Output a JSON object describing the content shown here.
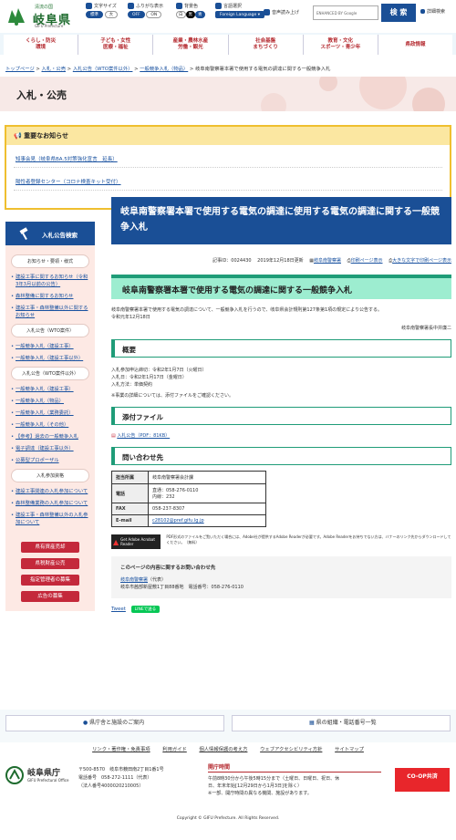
{
  "header": {
    "logo_sub": "清流の国",
    "logo_main": "岐阜県",
    "logo_en": "GIFU Prefecture",
    "font_size": {
      "label": "文字サイズ",
      "opt1": "標準",
      "opt2": "大"
    },
    "furigana": {
      "label": "ふりがな表示",
      "off": "OFF",
      "on": "ON"
    },
    "bg_color": {
      "label": "背景色",
      "opt1": "白",
      "opt2": "黒",
      "opt3": "青"
    },
    "language": {
      "label": "言語選択",
      "button": "Foreign Language ▾"
    },
    "voice": "音声読み上げ",
    "search_placeholder": "ENHANCED BY Google",
    "search_button": "検 索",
    "detail_search": "詳細検索",
    "colors": {
      "primary": "#1a4f96",
      "green": "#1f9c78",
      "red": "#c4293b"
    }
  },
  "nav": [
    {
      "l1": "くらし・防災",
      "l2": "環境"
    },
    {
      "l1": "子ども・女性",
      "l2": "医療・福祉"
    },
    {
      "l1": "産業・農林水産",
      "l2": "労働・観光"
    },
    {
      "l1": "社会基盤",
      "l2": "まちづくり"
    },
    {
      "l1": "教育・文化",
      "l2": "スポーツ・青少年"
    },
    {
      "l1": "県政情報",
      "l2": ""
    }
  ],
  "breadcrumb": {
    "items": [
      "トップページ",
      "入札・公売",
      "入札公告（WTO案件以外）",
      "一般競争入札（物品）"
    ],
    "current": "岐阜南警察署本署で使用する電気の調達に関する一般競争入札"
  },
  "banner_title": "入札・公売",
  "notice": {
    "title": "重要なお知らせ",
    "items": [
      "知事会見（岐阜県BA.5対策強化宣言　延長）",
      "陽性者登録センター（コロナ検査キット受付）"
    ]
  },
  "sidebar": {
    "title": "入札公告検索",
    "sec1": "お知らせ・要領・様式",
    "sec1_links": [
      "建設工事に関するお知らせ（令和3年3月以前の公告）",
      "森林整備に関するお知らせ",
      "建設工事・森林整備以外に関するお知らせ"
    ],
    "sec2": "入札公告（WTO案件）",
    "sec2_links": [
      "一般競争入札（建設工事）",
      "一般競争入札（建設工事以外）"
    ],
    "sec3": "入札公告（WTO案件以外）",
    "sec3_links": [
      "一般競争入札（建設工事）",
      "一般競争入札（物品）",
      "一般競争入札（業務委託）",
      "一般競争入札（その他）",
      "【参考】過去の一般競争入札",
      "電子調達（建設工事以外）",
      "公募型プロポーザル"
    ],
    "sec4": "入札参加資格",
    "sec4_links": [
      "建設工事関連の入札参加について",
      "森林整備業務の入札参加について",
      "建設工事・森林整備以外の入札参加について"
    ],
    "buttons": [
      "県有資産売却",
      "県税財産公売",
      "指定管理者の募集",
      "広告の募集"
    ]
  },
  "main": {
    "title": "岐阜南警察署本署で使用する電気の調達に使用する電気の調達に関する一般競争入札",
    "meta_id": "記事ID：0024430",
    "meta_date": "2019年12月18日更新",
    "meta_dept": "岐阜南警察署",
    "meta_print": "印刷ページ表示",
    "meta_large": "大きな文字で印刷ページ表示",
    "h2": "岐阜南警察署本署で使用する電気の調達に関する一般競争入札",
    "intro1": "岐阜南警察署本署で使用する電気の調達について、一般競争入札を行うので、岐阜県会計規則第127条第1項の規定により公告する。",
    "intro2": "令和元年12月18日",
    "signer": "岐阜南警察署長中井廉二",
    "gaiyou_title": "概要",
    "gaiyou": [
      "入札参加申込締切：令和2年1月7日（火曜日）",
      "入札日：令和2年1月17日（金曜日）",
      "入札方法：単価契約"
    ],
    "gaiyou_note": "※事業の詳細については、添付ファイルをご確認ください。",
    "attach_title": "添付ファイル",
    "attach_link": "入札公告（PDF：81KB）",
    "contact_title": "問い合わせ先",
    "contact": [
      {
        "k": "担当所属",
        "v": "岐阜南警察署会計課"
      },
      {
        "k": "電話",
        "v": "直通：058-276-0110",
        "v2": "内線：232"
      },
      {
        "k": "FAX",
        "v": "058-237-8307"
      },
      {
        "k": "E-mail",
        "v": "c28102@pref.gifu.lg.jp"
      }
    ],
    "adobe_logo": "Get Adobe Acrobat Reader",
    "adobe_text": "PDF形式のファイルをご覧いただく場合には、Adobe社が提供するAdobe Readerが必要です。Adobe Readerをお持ちでない方は、バナーのリンク先からダウンロードしてください。（無料）",
    "inquiry_title": "このページの内容に関するお問い合わせ先",
    "inquiry_dept": "岐阜南警察署",
    "inquiry_dept_suffix": "（代表）",
    "inquiry_addr": "岐阜市茜部新屋敷1丁目88番地　電話番号：058-276-0110",
    "tweet": "Tweet",
    "line": "LINEで送る"
  },
  "footer": {
    "btn1": "県庁舎と施設のご案内",
    "btn2": "県の組織・電話番号一覧",
    "links": [
      "リンク・著作権・免責事項",
      "利用ガイド",
      "個人情報保護の考え方",
      "ウェブアクセシビリティ方針",
      "サイトマップ"
    ],
    "org": "岐阜県庁",
    "org_en": "GIFU Prefectural Office",
    "addr1": "〒500-8570　岐阜市薮田南2丁目1番1号",
    "addr2": "電話番号　058-272-1111（代表）",
    "addr3": "（法人番号4000020210005）",
    "hours_title": "開庁時間",
    "hours1": "午前8時30分から午後5時15分まで（土曜日、日曜日、祝日、休",
    "hours2": "日、年末年始[12月29日から1月3日]を除く）",
    "hours3": "※一部、開庁時間の異なる機関、施設があります。",
    "coop": "CO-OP共済",
    "copyright": "Copyright © GIFU Prefecture. All Rights Reserved."
  }
}
